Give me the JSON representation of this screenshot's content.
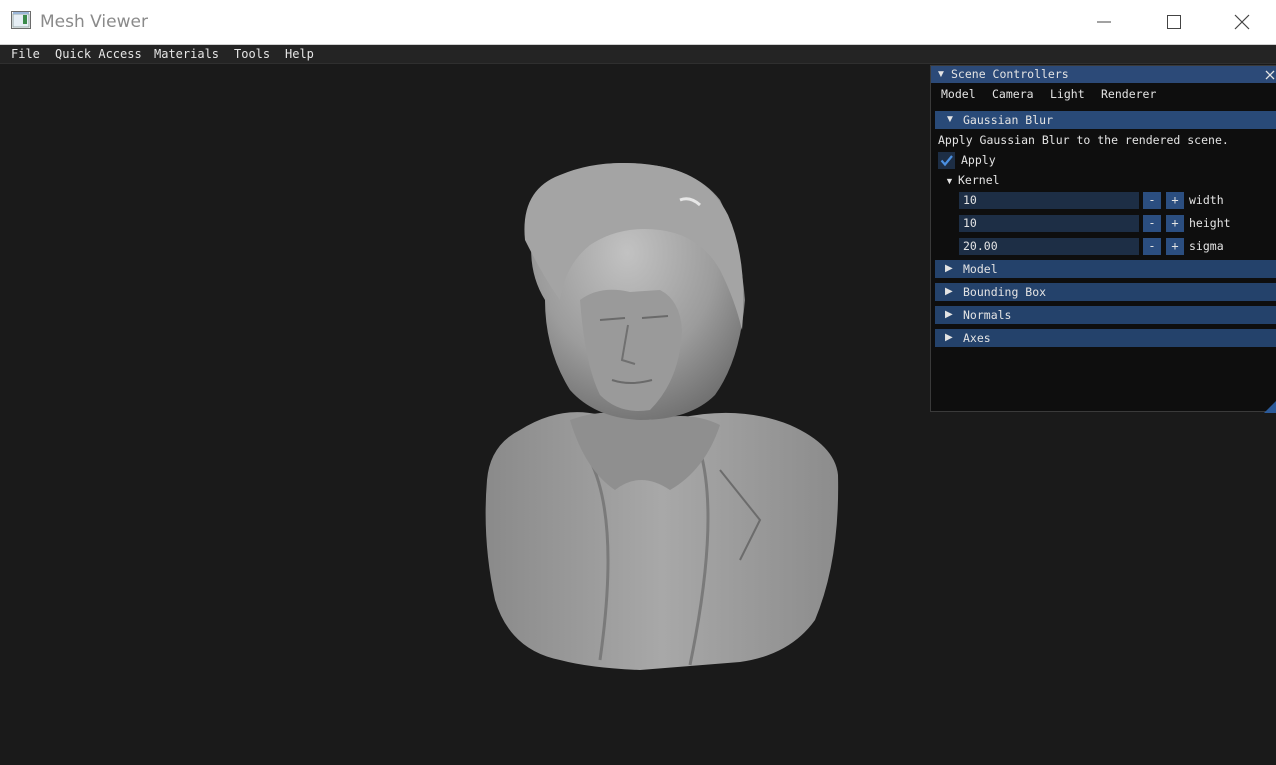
{
  "window": {
    "title": "Mesh Viewer"
  },
  "menu": [
    "File",
    "Quick Access",
    "Materials",
    "Tools",
    "Help"
  ],
  "panel": {
    "title": "Scene Controllers",
    "tabs": [
      "Model",
      "Camera",
      "Light",
      "Renderer"
    ],
    "blur": {
      "header": "Gaussian Blur",
      "description": "Apply Gaussian Blur to the rendered scene.",
      "apply_label": "Apply",
      "apply_checked": true,
      "kernel_label": "Kernel",
      "params": [
        {
          "value": "10",
          "label": "width"
        },
        {
          "value": "10",
          "label": "height"
        },
        {
          "value": "20.00",
          "label": "sigma"
        }
      ],
      "minus": "-",
      "plus": "+"
    },
    "sections": [
      "Model",
      "Bounding Box",
      "Normals",
      "Axes"
    ]
  },
  "colors": {
    "panel_title": "#2c4a78",
    "section_header": "#24426b",
    "accent_check": "#4a90e2",
    "viewport_bg": "#1a1a1a"
  }
}
